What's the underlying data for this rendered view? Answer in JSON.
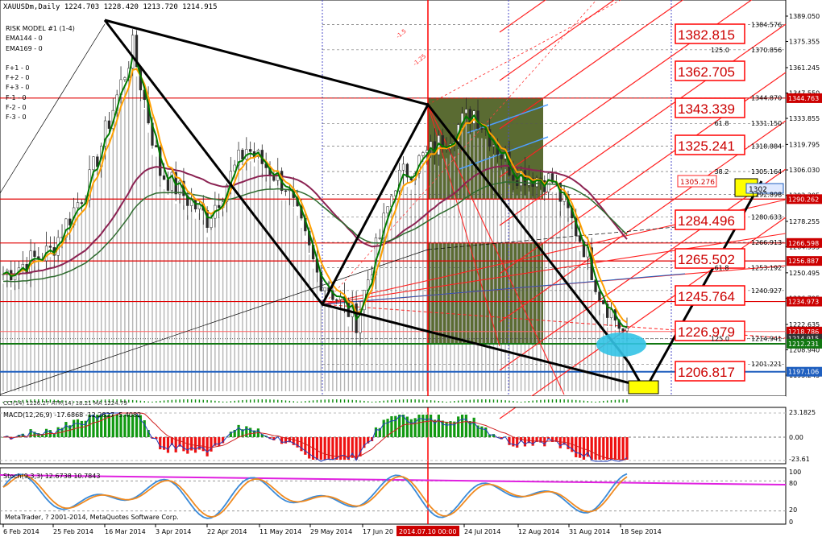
{
  "header": {
    "symbol_line": "XAUUSDm,Daily  1224.703 1228.420 1213.720 1214.915",
    "indicator_lines": [
      "RISK MODEL #1 (1-4)",
      "EMA144 - 0",
      "EMA169 - 0",
      "F+1 - 0",
      "F+2 - 0",
      "F+3 - 0",
      "F-1 - 0",
      "F-2 - 0",
      "F-3 - 0"
    ]
  },
  "price_axis": {
    "ticks": [
      "1389.050",
      "1375.355",
      "1361.245",
      "1347.550",
      "1333.855",
      "1319.795",
      "1306.030",
      "1292.305",
      "1278.255",
      "1264.555",
      "1250.495",
      "1236.795",
      "1222.635",
      "1208.940",
      "1195.245"
    ]
  },
  "level_boxes": [
    {
      "label": "1382.815"
    },
    {
      "label": "1362.705"
    },
    {
      "label": "1343.339"
    },
    {
      "label": "1325.241"
    },
    {
      "label": "1284.496"
    },
    {
      "label": "1265.502"
    },
    {
      "label": "1245.764"
    },
    {
      "label": "1226.979"
    },
    {
      "label": "1206.817"
    }
  ],
  "fib_labels": [
    {
      "ratio": "",
      "price": "1384.576"
    },
    {
      "ratio": "125.0",
      "price": "1370.856"
    },
    {
      "ratio": "",
      "price": "1344.870"
    },
    {
      "ratio": "61.8",
      "price": "1331.150"
    },
    {
      "ratio": "",
      "price": "1318.884"
    },
    {
      "ratio": "38.2",
      "price": "1305.164"
    },
    {
      "ratio": "",
      "price": "1292.898"
    },
    {
      "ratio": "",
      "price": "1280.633"
    },
    {
      "ratio": "",
      "price": "1266.913"
    },
    {
      "ratio": "61.8",
      "price": "1253.192"
    },
    {
      "ratio": "",
      "price": "1240.927"
    },
    {
      "ratio": "125.0",
      "price": "1214.941"
    },
    {
      "ratio": "",
      "price": "1201.221"
    }
  ],
  "price_tags": [
    {
      "label": "1344.763",
      "color": "#cc0000"
    },
    {
      "label": "1290.262",
      "color": "#cc0000"
    },
    {
      "label": "1266.598",
      "color": "#cc0000"
    },
    {
      "label": "1256.887",
      "color": "#cc0000"
    },
    {
      "label": "1234.973",
      "color": "#cc0000"
    },
    {
      "label": "1218.786",
      "color": "#cc0000"
    },
    {
      "label": "1214.915",
      "color": "#333333"
    },
    {
      "label": "1212.231",
      "color": "#117711"
    },
    {
      "label": "1197.106",
      "color": "#1f5fbf"
    }
  ],
  "chart_labels": {
    "box_1305": "1305.276",
    "box_1302": "1302",
    "fan_a": "-1.5",
    "fan_b": "-1.25"
  },
  "macd": {
    "label": "MACD(12,26,9) -17.6868 -12.2827 -5.4082",
    "ticks": [
      "23.1825",
      "0.00",
      "-23.61"
    ]
  },
  "stoch": {
    "label": "Stoch(9,3,3) 12.6738 10.7843",
    "ticks": [
      "100",
      "80",
      "20",
      "0"
    ]
  },
  "footer_text": "MetaTrader, ? 2001-2014, MetaQuotes Software Corp.",
  "mini_label": "CCI(14) 1226.27  ATR(14) 18.21  MA 1224.79",
  "time_axis": {
    "dates": [
      "6 Feb 2014",
      "25 Feb 2014",
      "16 Mar 2014",
      "3 Apr 2014",
      "22 Apr 2014",
      "11 May 2014",
      "29 May 2014",
      "17 Jun 20",
      "24 Jul 2014",
      "12 Aug 2014",
      "31 Aug 2014",
      "18 Sep 2014"
    ],
    "highlight": "2014.07.10 00:00"
  },
  "colors": {
    "red": "#ff0000",
    "green": "#007a00",
    "orange": "#ffa000",
    "blue": "#1f5fbf",
    "grid": "#8fa2b5"
  }
}
